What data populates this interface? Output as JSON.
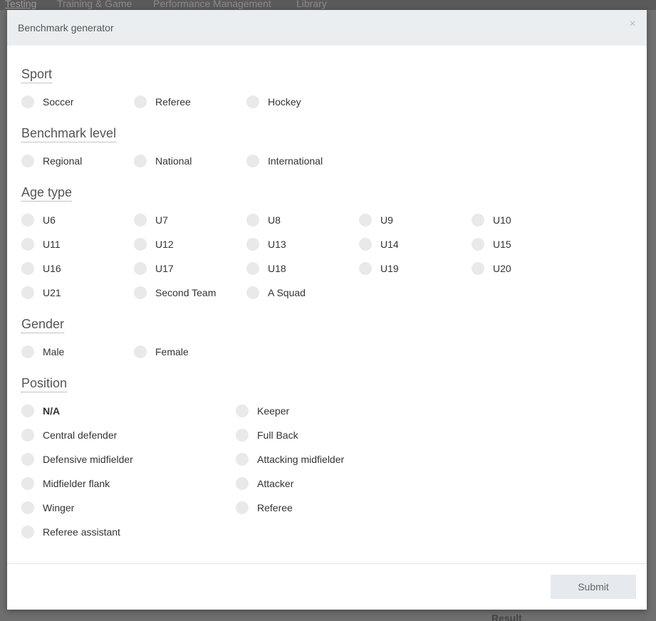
{
  "background": {
    "nav": [
      "Testing",
      "Training & Game",
      "Performance Management",
      "Library"
    ],
    "result_label": "Result"
  },
  "modal": {
    "title": "Benchmark generator",
    "close_glyph": "×",
    "submit_label": "Submit"
  },
  "sections": {
    "sport": {
      "title": "Sport",
      "options": [
        "Soccer",
        "Referee",
        "Hockey"
      ]
    },
    "benchmark_level": {
      "title": "Benchmark level",
      "options": [
        "Regional",
        "National",
        "International"
      ]
    },
    "age_type": {
      "title": "Age type",
      "options": [
        "U6",
        "U7",
        "U8",
        "U9",
        "U10",
        "U11",
        "U12",
        "U13",
        "U14",
        "U15",
        "U16",
        "U17",
        "U18",
        "U19",
        "U20",
        "U21",
        "Second Team",
        "A Squad"
      ]
    },
    "gender": {
      "title": "Gender",
      "options": [
        "Male",
        "Female"
      ]
    },
    "position": {
      "title": "Position",
      "options": [
        "N/A",
        "Keeper",
        "Central defender",
        "Full Back",
        "Defensive midfielder",
        "Attacking midfielder",
        "Midfielder flank",
        "Attacker",
        "Winger",
        "Referee",
        "Referee assistant"
      ]
    }
  }
}
